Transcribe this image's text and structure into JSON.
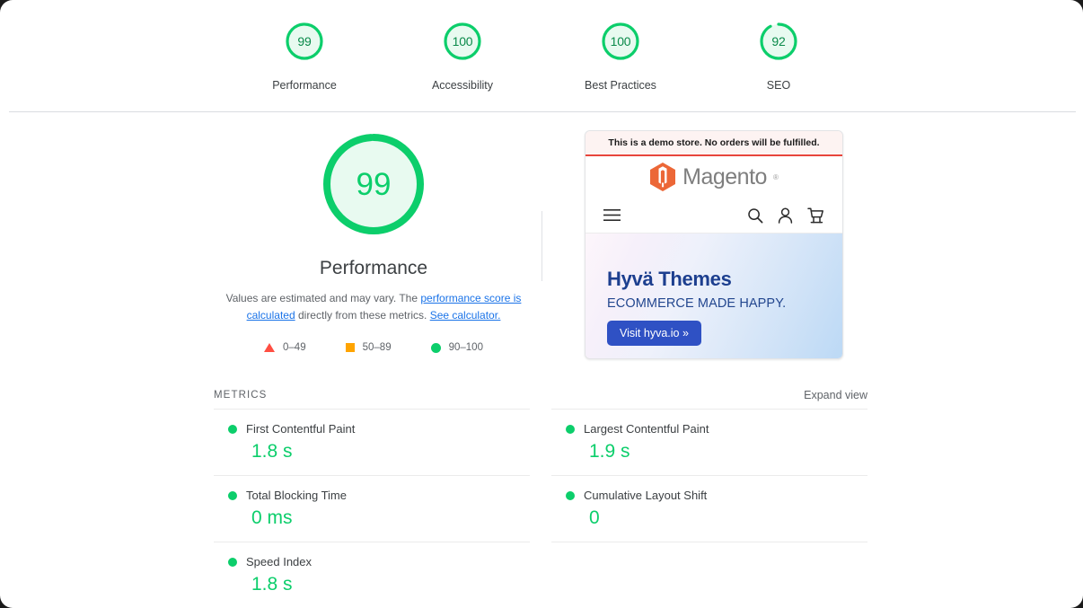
{
  "topbar": {
    "scores": [
      {
        "value": "99",
        "label": "Performance",
        "pct": 99,
        "color": "#0cce6b"
      },
      {
        "value": "100",
        "label": "Accessibility",
        "pct": 100,
        "color": "#0cce6b"
      },
      {
        "value": "100",
        "label": "Best Practices",
        "pct": 100,
        "color": "#0cce6b"
      },
      {
        "value": "92",
        "label": "SEO",
        "pct": 92,
        "color": "#0cce6b"
      }
    ]
  },
  "gauge": {
    "score": "99",
    "pct": 99,
    "title": "Performance",
    "color": "#0cce6b",
    "desc_part1": "Values are estimated and may vary. The ",
    "desc_link1": "performance score is calculated",
    "desc_part2": " directly from these metrics. ",
    "desc_link2": "See calculator."
  },
  "legend": {
    "items": [
      {
        "icon": "triangle-icon",
        "range": "0–49",
        "color": "#ff4e42"
      },
      {
        "icon": "square-icon",
        "range": "50–89",
        "color": "#ffa400"
      },
      {
        "icon": "circle-icon",
        "range": "90–100",
        "color": "#0cce6b"
      }
    ]
  },
  "thumbnail": {
    "demo_banner": "This is a demo store. No orders will be fulfilled.",
    "logo_text": "Magento",
    "logo_registered": "®",
    "nav_icons": [
      "hamburger-icon",
      "search-icon",
      "account-icon",
      "cart-icon"
    ],
    "hero_title": "Hyvä Themes",
    "hero_subtitle": "ECOMMERCE MADE HAPPY.",
    "hero_button": "Visit hyva.io »"
  },
  "metrics": {
    "section_label": "METRICS",
    "expand_label": "Expand view",
    "items": [
      {
        "name": "First Contentful Paint",
        "value": "1.8 s",
        "status": "pass",
        "color": "#0cce6b"
      },
      {
        "name": "Largest Contentful Paint",
        "value": "1.9 s",
        "status": "pass",
        "color": "#0cce6b"
      },
      {
        "name": "Total Blocking Time",
        "value": "0 ms",
        "status": "pass",
        "color": "#0cce6b"
      },
      {
        "name": "Cumulative Layout Shift",
        "value": "0",
        "status": "pass",
        "color": "#0cce6b"
      },
      {
        "name": "Speed Index",
        "value": "1.8 s",
        "status": "pass",
        "color": "#0cce6b"
      }
    ]
  }
}
